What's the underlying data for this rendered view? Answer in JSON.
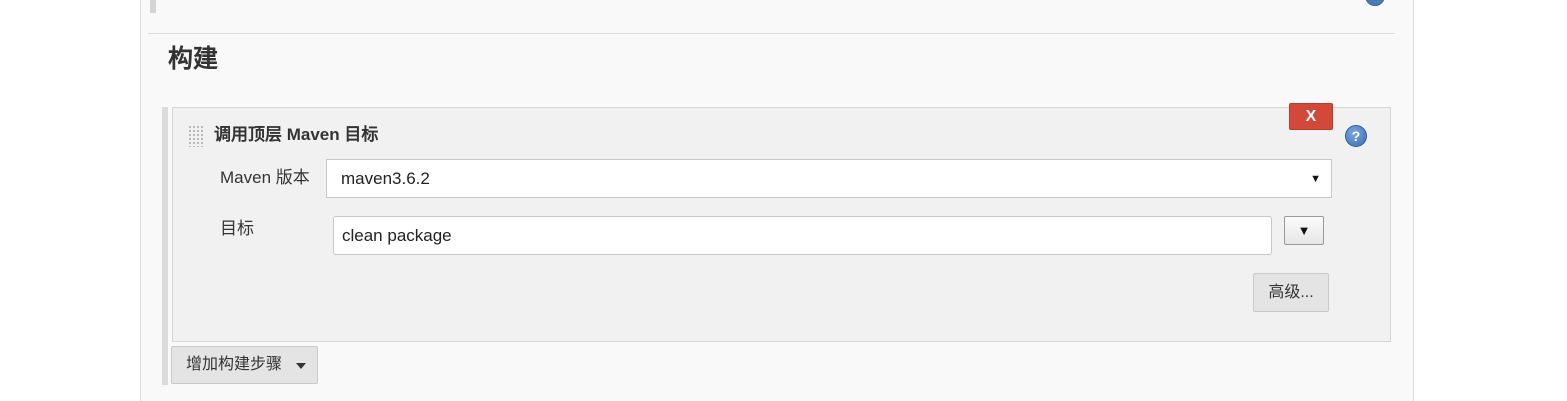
{
  "build_section": {
    "title": "构建"
  },
  "step": {
    "title": "调用顶层 Maven 目标",
    "delete_label": "X",
    "help_label": "?",
    "maven_version": {
      "label": "Maven 版本",
      "selected": "maven3.6.2",
      "arrow": "▼"
    },
    "goals": {
      "label": "目标",
      "value": "clean package",
      "expand_label": "▼"
    },
    "advanced_label": "高级..."
  },
  "add_step": {
    "label": "增加构建步骤"
  },
  "colors": {
    "delete": "#d24939",
    "help": "#3a6db0",
    "panel_bg": "#f9f9f9",
    "step_bg": "#f1f1f1"
  },
  "icons": {
    "drag": "drag-handle-icon",
    "help": "help-icon",
    "caret": "caret-down-icon"
  }
}
